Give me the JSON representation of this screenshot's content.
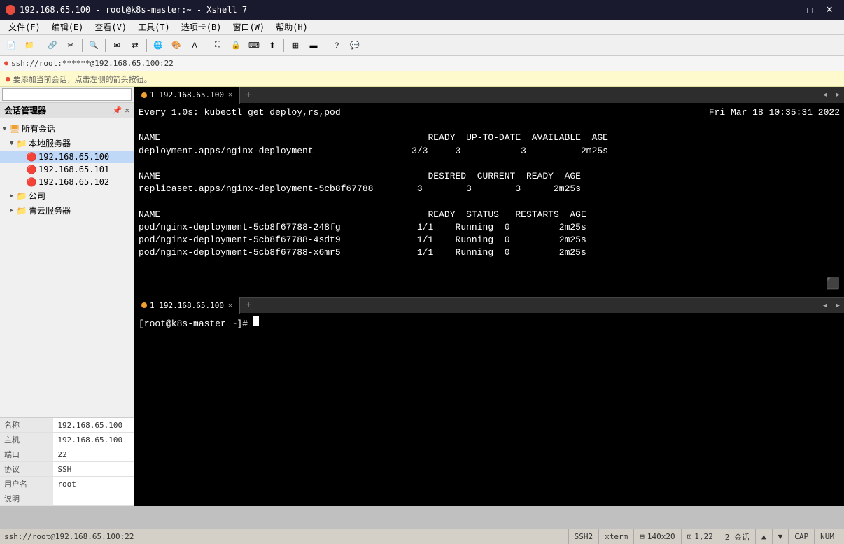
{
  "window": {
    "title": "192.168.65.100 - root@k8s-master:~ - Xshell 7",
    "icon": "●"
  },
  "menu": {
    "items": [
      "文件(F)",
      "编辑(E)",
      "查看(V)",
      "工具(T)",
      "选项卡(B)",
      "窗口(W)",
      "帮助(H)"
    ]
  },
  "addr_bar": {
    "text": "ssh://root:******@192.168.65.100:22"
  },
  "hint_bar": {
    "text": "要添加当前会话，点击左侧的箭头按钮。"
  },
  "left_panel": {
    "title": "会话管理器",
    "tree": [
      {
        "label": "所有会话",
        "level": 0,
        "type": "root",
        "expanded": true
      },
      {
        "label": "本地服务器",
        "level": 1,
        "type": "folder",
        "expanded": true
      },
      {
        "label": "192.168.65.100",
        "level": 2,
        "type": "server",
        "active": true
      },
      {
        "label": "192.168.65.101",
        "level": 2,
        "type": "server"
      },
      {
        "label": "192.168.65.102",
        "level": 2,
        "type": "server"
      },
      {
        "label": "公司",
        "level": 1,
        "type": "folder",
        "expanded": false
      },
      {
        "label": "青云服务器",
        "level": 1,
        "type": "folder",
        "expanded": false
      }
    ],
    "search_placeholder": ""
  },
  "properties": {
    "rows": [
      {
        "key": "名称",
        "value": "192.168.65.100"
      },
      {
        "key": "主机",
        "value": "192.168.65.100"
      },
      {
        "key": "端口",
        "value": "22"
      },
      {
        "key": "协议",
        "value": "SSH"
      },
      {
        "key": "用户名",
        "value": "root"
      },
      {
        "key": "说明",
        "value": ""
      }
    ]
  },
  "terminal_upper": {
    "tab_label": "1 192.168.65.100",
    "command_line": "Every 1.0s: kubectl get deploy,rs,pod",
    "timestamp": "Fri Mar 18 10:35:31 2022",
    "sections": [
      {
        "headers": [
          "NAME",
          "READY",
          "UP-TO-DATE",
          "AVAILABLE",
          "AGE"
        ],
        "rows": [
          [
            "deployment.apps/nginx-deployment",
            "3/3",
            "3",
            "3",
            "2m25s"
          ]
        ]
      },
      {
        "headers": [
          "NAME",
          "DESIRED",
          "CURRENT",
          "READY",
          "AGE"
        ],
        "rows": [
          [
            "replicaset.apps/nginx-deployment-5cb8f67788",
            "3",
            "3",
            "3",
            "2m25s"
          ]
        ]
      },
      {
        "headers": [
          "NAME",
          "READY",
          "STATUS",
          "RESTARTS",
          "AGE"
        ],
        "rows": [
          [
            "pod/nginx-deployment-5cb8f67788-248fg",
            "1/1",
            "Running",
            "0",
            "2m25s"
          ],
          [
            "pod/nginx-deployment-5cb8f67788-4sdt9",
            "1/1",
            "Running",
            "0",
            "2m25s"
          ],
          [
            "pod/nginx-deployment-5cb8f67788-x6mr5",
            "1/1",
            "Running",
            "0",
            "2m25s"
          ]
        ]
      }
    ]
  },
  "terminal_lower": {
    "tab_label": "1 192.168.65.100",
    "prompt": "[root@k8s-master ~]# "
  },
  "status_bar": {
    "left": "ssh://root@192.168.65.100:22",
    "items": [
      "SSH2",
      "xterm",
      "140x20",
      "1,22",
      "2 会话",
      "▲",
      "▼",
      "CAP",
      "NUM"
    ]
  }
}
